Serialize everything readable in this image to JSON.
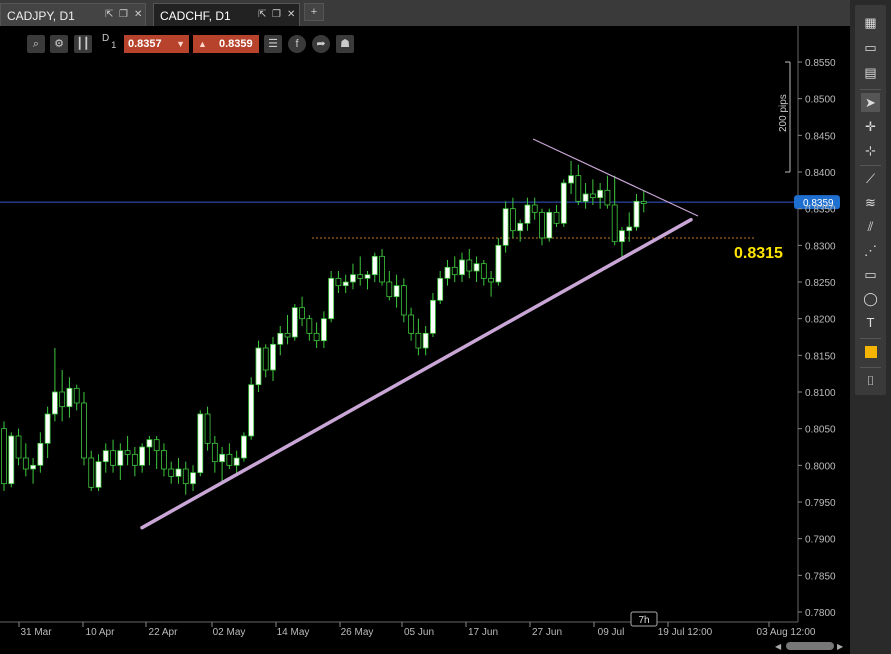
{
  "tabs": [
    {
      "label": "CADJPY, D1",
      "active": false
    },
    {
      "label": "CADCHF, D1",
      "active": true
    }
  ],
  "add_tab_label": "+",
  "toolbar": {
    "timeframe": "D",
    "timeframe_mult": "1",
    "sell_price": "0.8357",
    "buy_price": "0.8359",
    "icons": [
      "zoom-icon",
      "settings-icon",
      "candle-type-icon",
      "list-icon",
      "facebook-icon",
      "share-icon",
      "person-icon"
    ]
  },
  "sidebar": {
    "icons": [
      "layout-grid-icon",
      "single-window-icon",
      "split-window-icon",
      "cursor-icon",
      "crosshair-icon",
      "cross-plus-icon",
      "trendline-icon",
      "fibonacci-icon",
      "pitchfork-icon",
      "fib-extension-icon",
      "rectangle-icon",
      "circle-icon",
      "text-icon",
      "color-swatch-icon",
      "camera-icon"
    ],
    "color_swatch": "#f5b400"
  },
  "colors": {
    "background": "#000000",
    "bull_candle": "#ffffff",
    "bear_candle": "#000000",
    "wick": "#3ec83e",
    "support_line": "#c9a6d6",
    "price_line": "#3658c8",
    "price_tag": "#1f6fd0",
    "level_line": "#c07a2a",
    "level_label": "#ffe600"
  },
  "chart_data": {
    "type": "candlestick",
    "symbol": "CADCHF",
    "timeframe": "D1",
    "current_price": "0.8359",
    "current_time_label": "7h",
    "price_ticks": [
      "0.8550",
      "0.8500",
      "0.8450",
      "0.8400",
      "0.8359",
      "0.8350",
      "0.8300",
      "0.8250",
      "0.8200",
      "0.8150",
      "0.8100",
      "0.8050",
      "0.8000",
      "0.7950",
      "0.7900",
      "0.7850",
      "0.7800"
    ],
    "price_tick_values": [
      0.855,
      0.85,
      0.845,
      0.84,
      0.8359,
      0.835,
      0.83,
      0.825,
      0.82,
      0.815,
      0.81,
      0.805,
      0.8,
      0.795,
      0.79,
      0.785,
      0.78
    ],
    "time_labels": [
      "31 Mar",
      "10 Apr",
      "22 Apr",
      "02 May",
      "14 May",
      "26 May",
      "05 Jun",
      "17 Jun",
      "27 Jun",
      "09 Jul",
      "19 Jul 12:00",
      "03 Aug 12:00"
    ],
    "ruler_label": "200 pips",
    "ruler_range": [
      0.84,
      0.855
    ],
    "horizontal_level": {
      "value": 0.831,
      "label": "0.8315"
    },
    "support_trendline": {
      "from": [
        "22 Apr",
        0.7915
      ],
      "to": [
        "18 Jul",
        0.8335
      ]
    },
    "resistance_trendline": {
      "from": [
        "27 Jun",
        0.8445
      ],
      "to": [
        "18 Jul",
        0.834
      ]
    },
    "candles": [
      [
        0.805,
        0.806,
        0.7965,
        0.7975
      ],
      [
        0.7975,
        0.8045,
        0.797,
        0.804
      ],
      [
        0.804,
        0.805,
        0.8,
        0.801
      ],
      [
        0.801,
        0.803,
        0.7985,
        0.7995
      ],
      [
        0.7995,
        0.801,
        0.7975,
        0.8
      ],
      [
        0.8,
        0.8045,
        0.799,
        0.803
      ],
      [
        0.803,
        0.808,
        0.801,
        0.807
      ],
      [
        0.807,
        0.816,
        0.806,
        0.81
      ],
      [
        0.81,
        0.813,
        0.806,
        0.808
      ],
      [
        0.808,
        0.812,
        0.8065,
        0.8105
      ],
      [
        0.8105,
        0.811,
        0.8075,
        0.8085
      ],
      [
        0.8085,
        0.81,
        0.8,
        0.801
      ],
      [
        0.801,
        0.802,
        0.7965,
        0.797
      ],
      [
        0.797,
        0.8015,
        0.7965,
        0.8005
      ],
      [
        0.8005,
        0.803,
        0.799,
        0.802
      ],
      [
        0.802,
        0.8035,
        0.799,
        0.8
      ],
      [
        0.8,
        0.803,
        0.798,
        0.802
      ],
      [
        0.802,
        0.804,
        0.8,
        0.8015
      ],
      [
        0.8015,
        0.8025,
        0.7985,
        0.8
      ],
      [
        0.8,
        0.803,
        0.799,
        0.8025
      ],
      [
        0.8025,
        0.804,
        0.8,
        0.8035
      ],
      [
        0.8035,
        0.804,
        0.7995,
        0.802
      ],
      [
        0.802,
        0.803,
        0.7985,
        0.7995
      ],
      [
        0.7995,
        0.8005,
        0.7975,
        0.7985
      ],
      [
        0.7985,
        0.801,
        0.7975,
        0.7995
      ],
      [
        0.7995,
        0.8005,
        0.796,
        0.7975
      ],
      [
        0.7975,
        0.8,
        0.7965,
        0.799
      ],
      [
        0.799,
        0.8075,
        0.7985,
        0.807
      ],
      [
        0.807,
        0.808,
        0.802,
        0.803
      ],
      [
        0.803,
        0.804,
        0.799,
        0.8005
      ],
      [
        0.8005,
        0.8025,
        0.7975,
        0.8015
      ],
      [
        0.8015,
        0.803,
        0.7995,
        0.8
      ],
      [
        0.8,
        0.802,
        0.7985,
        0.801
      ],
      [
        0.801,
        0.8045,
        0.8005,
        0.804
      ],
      [
        0.804,
        0.812,
        0.8035,
        0.811
      ],
      [
        0.811,
        0.817,
        0.81,
        0.816
      ],
      [
        0.816,
        0.8165,
        0.812,
        0.813
      ],
      [
        0.813,
        0.8175,
        0.8115,
        0.8165
      ],
      [
        0.8165,
        0.819,
        0.815,
        0.818
      ],
      [
        0.818,
        0.8205,
        0.8165,
        0.8175
      ],
      [
        0.8175,
        0.822,
        0.817,
        0.8215
      ],
      [
        0.8215,
        0.823,
        0.819,
        0.82
      ],
      [
        0.82,
        0.8205,
        0.817,
        0.818
      ],
      [
        0.818,
        0.8195,
        0.816,
        0.817
      ],
      [
        0.817,
        0.821,
        0.816,
        0.82
      ],
      [
        0.82,
        0.8265,
        0.8195,
        0.8255
      ],
      [
        0.8255,
        0.8265,
        0.8235,
        0.8245
      ],
      [
        0.8245,
        0.826,
        0.8235,
        0.825
      ],
      [
        0.825,
        0.8275,
        0.824,
        0.826
      ],
      [
        0.826,
        0.8285,
        0.8245,
        0.8255
      ],
      [
        0.8255,
        0.8265,
        0.824,
        0.826
      ],
      [
        0.826,
        0.829,
        0.825,
        0.8285
      ],
      [
        0.8285,
        0.8295,
        0.8245,
        0.825
      ],
      [
        0.825,
        0.8265,
        0.8225,
        0.823
      ],
      [
        0.823,
        0.826,
        0.8215,
        0.8245
      ],
      [
        0.8245,
        0.8255,
        0.8195,
        0.8205
      ],
      [
        0.8205,
        0.8215,
        0.817,
        0.818
      ],
      [
        0.818,
        0.82,
        0.815,
        0.816
      ],
      [
        0.816,
        0.819,
        0.815,
        0.818
      ],
      [
        0.818,
        0.8235,
        0.8175,
        0.8225
      ],
      [
        0.8225,
        0.8265,
        0.822,
        0.8255
      ],
      [
        0.8255,
        0.828,
        0.8245,
        0.827
      ],
      [
        0.827,
        0.8285,
        0.825,
        0.826
      ],
      [
        0.826,
        0.829,
        0.825,
        0.828
      ],
      [
        0.828,
        0.8295,
        0.8255,
        0.8265
      ],
      [
        0.8265,
        0.8285,
        0.825,
        0.8275
      ],
      [
        0.8275,
        0.828,
        0.8245,
        0.8255
      ],
      [
        0.8255,
        0.8265,
        0.823,
        0.825
      ],
      [
        0.825,
        0.831,
        0.8245,
        0.83
      ],
      [
        0.83,
        0.836,
        0.829,
        0.835
      ],
      [
        0.835,
        0.8365,
        0.831,
        0.832
      ],
      [
        0.832,
        0.8335,
        0.8305,
        0.833
      ],
      [
        0.833,
        0.8365,
        0.832,
        0.8355
      ],
      [
        0.8355,
        0.8365,
        0.8335,
        0.8345
      ],
      [
        0.8345,
        0.835,
        0.83,
        0.831
      ],
      [
        0.831,
        0.835,
        0.8305,
        0.8345
      ],
      [
        0.8345,
        0.8355,
        0.8325,
        0.833
      ],
      [
        0.833,
        0.839,
        0.8325,
        0.8385
      ],
      [
        0.8385,
        0.8415,
        0.837,
        0.8395
      ],
      [
        0.8395,
        0.841,
        0.8355,
        0.836
      ],
      [
        0.836,
        0.8385,
        0.835,
        0.837
      ],
      [
        0.837,
        0.839,
        0.8355,
        0.8365
      ],
      [
        0.8365,
        0.8385,
        0.835,
        0.8375
      ],
      [
        0.8375,
        0.8395,
        0.835,
        0.8355
      ],
      [
        0.8355,
        0.8395,
        0.83,
        0.8305
      ],
      [
        0.8305,
        0.8325,
        0.828,
        0.832
      ],
      [
        0.832,
        0.8345,
        0.8305,
        0.8325
      ],
      [
        0.8325,
        0.837,
        0.832,
        0.836
      ],
      [
        0.836,
        0.8375,
        0.8345,
        0.8357
      ]
    ]
  }
}
